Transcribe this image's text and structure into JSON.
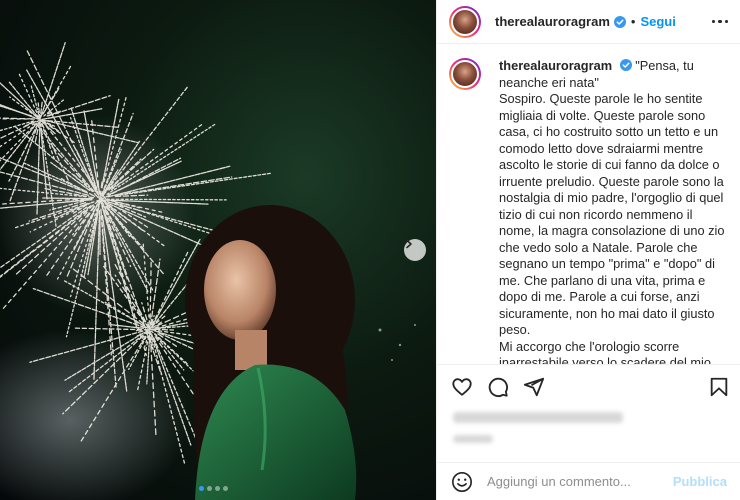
{
  "post": {
    "username": "therealauroragram",
    "separator": "•",
    "follow_label": "Segui",
    "verified_icon": "verified-badge-icon",
    "more_icon": "more-options-icon"
  },
  "caption": {
    "username": "therealauroragram",
    "paragraphs": [
      "\"Pensa, tu neanche eri nata\"",
      "Sospiro. Queste parole le ho sentite migliaia di volte. Queste parole sono casa, ci ho costruito sotto un tetto e un comodo letto dove sdraiarmi mentre ascolto le storie di cui fanno da dolce o irruente preludio. Queste parole sono la nostalgia di mio padre, l'orgoglio di quel tizio di cui non ricordo nemmeno il nome, la magra consolazione di uno zio che vedo solo a Natale. Parole che segnano un tempo \"prima\" e \"dopo\" di me. Che parlano di una vita, prima e dopo di me. Parole a cui forse, anzi sicuramente, non ho mai dato il giusto peso.",
      "Mi accorgo che l'orologio scorre inarrestabile verso lo scadere del mio"
    ]
  },
  "actions": {
    "icons": [
      "heart-icon",
      "comment-icon",
      "share-icon",
      "bookmark-icon"
    ]
  },
  "comment": {
    "placeholder": "Aggiungi un commento...",
    "publish_label": "Pubblica"
  },
  "carousel": {
    "total_slides": 4,
    "active_index": 0
  },
  "colors": {
    "link_blue": "#0095f6",
    "publish_disabled": "#b2dffc",
    "dot_active": "#3897f0"
  }
}
